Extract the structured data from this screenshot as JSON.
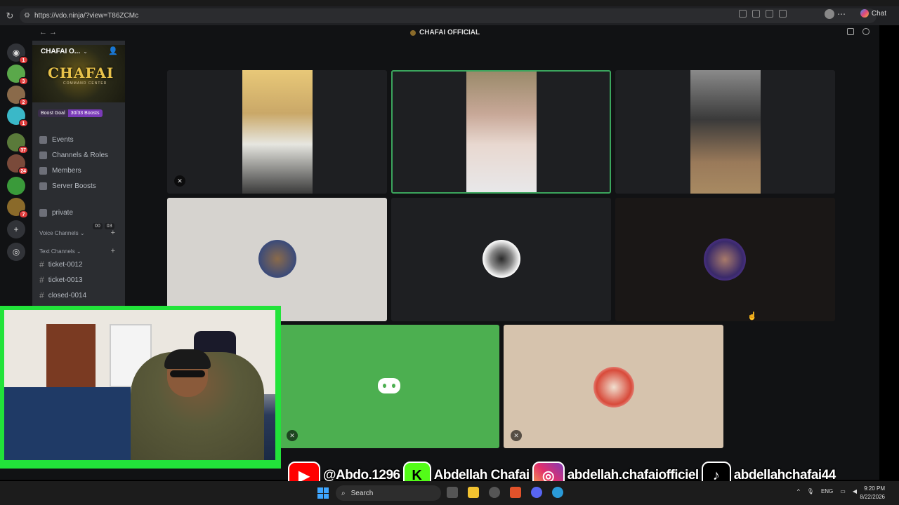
{
  "browser": {
    "url": "https://vdo.ninja/?view=T86ZCMc",
    "chat_label": "Chat"
  },
  "app": {
    "title": "CHAFAI OFFICIAL"
  },
  "guilds": [
    {
      "name": "discord-home",
      "color": "#313338",
      "badge": "1"
    },
    {
      "name": "guild-1",
      "color": "#5aa84a",
      "badge": "3"
    },
    {
      "name": "guild-2",
      "color": "#8a6a4a",
      "badge": "2"
    },
    {
      "name": "guild-3",
      "color": "#3ab8c8",
      "badge": "1"
    },
    {
      "name": "guild-4",
      "color": "#5a7a3a",
      "badge": "37"
    },
    {
      "name": "guild-5",
      "color": "#7a4a3a",
      "badge": "24"
    },
    {
      "name": "guild-6",
      "color": "#3a9a3a",
      "badge": ""
    },
    {
      "name": "guild-7",
      "color": "#8a6a2a",
      "badge": "7"
    }
  ],
  "sidebar": {
    "server_name": "CHAFAI O...",
    "banner_title": "CHAFAI",
    "banner_subtitle": "COMMAND CENTER",
    "boost_goal": "Boost Goal",
    "boost_count": "30/33 Boosts",
    "menu": [
      {
        "label": "Events"
      },
      {
        "label": "Channels & Roles"
      },
      {
        "label": "Members"
      },
      {
        "label": "Server Boosts"
      }
    ],
    "voice_item": {
      "label": "private",
      "count_a": "00",
      "count_b": "03"
    },
    "voice_section": "Voice Channels",
    "text_section": "Text Channels",
    "text_channels": [
      "ticket-0012",
      "ticket-0013",
      "closed-0014"
    ]
  },
  "social": {
    "youtube": "@Abdo.1296",
    "kick": "Abdellah Chafai",
    "instagram": "abdellah.chafaiofficiel",
    "tiktok": "abdellahchafai44"
  },
  "taskbar": {
    "search": "Search",
    "lang": "ENG",
    "time": "9:20 PM",
    "date": "8/22/2026"
  },
  "colors": {
    "accent_green": "#22e33a",
    "discord_green": "#4caf50",
    "boost_purple": "#7a3ab8"
  }
}
